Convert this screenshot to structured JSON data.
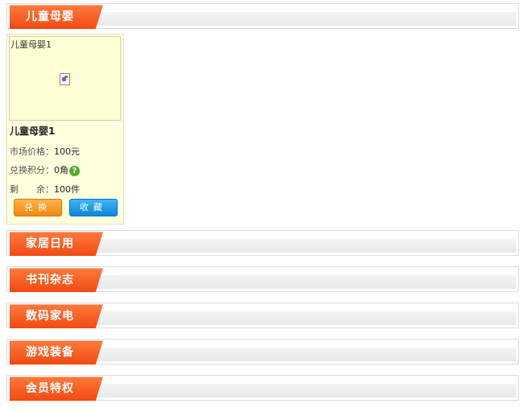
{
  "sections": [
    {
      "title": "儿童母婴"
    },
    {
      "title": "家居日用"
    },
    {
      "title": "书刊杂志"
    },
    {
      "title": "数码家电"
    },
    {
      "title": "游戏装备"
    },
    {
      "title": "会员特权"
    }
  ],
  "product": {
    "image_alt": "儿童母婴1",
    "name": "儿童母婴1",
    "market_price_label": "市场价格：",
    "market_price_value": "100元",
    "points_label": "兑换积分：",
    "points_value": "0角",
    "remaining_label": "剩　　余：",
    "remaining_value": "100件",
    "help_icon": "help-icon",
    "exchange_label": "兑换",
    "favorite_label": "收藏"
  },
  "colors": {
    "tab_orange": "#f24a12",
    "card_bg": "#ffffdd",
    "help_green": "#4caf24",
    "exchange_orange": "#f0880e",
    "favorite_blue": "#0d86d8"
  }
}
